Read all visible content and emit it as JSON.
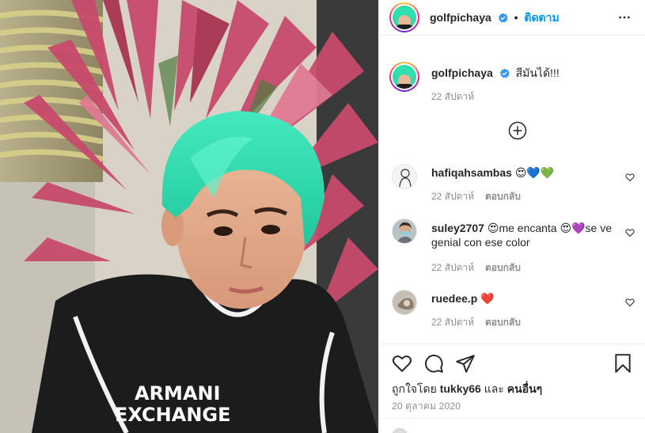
{
  "post": {
    "username": "golfpichaya",
    "follow_label": "ติดตาม",
    "caption_text": "สีมันได้!!!",
    "caption_time": "22 สัปดาห์",
    "likes_prefix": "ถูกใจโดย",
    "likes_user": "tukky66",
    "likes_connector": "และ",
    "likes_others": "คนอื่นๆ",
    "post_date": "20 ตุลาคม 2020",
    "photo_text_line1": "ARMANI",
    "photo_text_line2": "EXCHANGE"
  },
  "comments": [
    {
      "username": "hafiqahsambas",
      "text": "😍💙💚",
      "time": "22 สัปดาห์",
      "reply_label": "ตอบกลับ"
    },
    {
      "username": "suley2707",
      "text": "😍me encanta 😍💜se ve genial con ese color",
      "time": "22 สัปดาห์",
      "reply_label": "ตอบกลับ"
    },
    {
      "username": "ruedee.p",
      "text": "❤️",
      "time": "22 สัปดาห์",
      "reply_label": "ตอบกลับ"
    }
  ],
  "icons": {
    "verified": "verified-badge-icon",
    "more": "more-options-icon",
    "load_more": "load-more-comments-icon",
    "like": "heart-icon",
    "comment": "comment-icon",
    "share": "share-icon",
    "save": "bookmark-icon"
  },
  "colors": {
    "accent": "#0095f6",
    "hair": "#33e0b2",
    "muted_text": "#8e8e8e"
  }
}
